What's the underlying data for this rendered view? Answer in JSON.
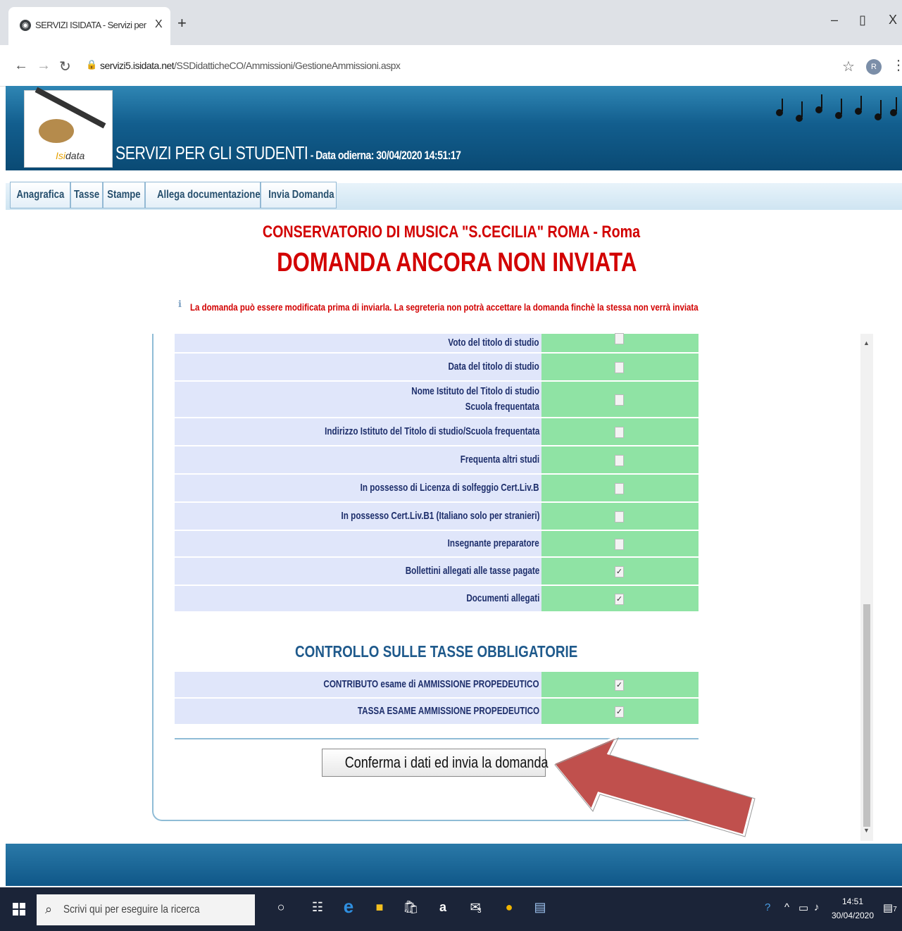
{
  "browser": {
    "tab_title": "SERVIZI ISIDATA - Servizi per gli s",
    "tab_close": "X",
    "new_tab": "+",
    "url_host": "servizi5.isidata.net",
    "url_path": "/SSDidatticheCO/Ammissioni/GestioneAmmissioni.aspx",
    "profile_initial": "R",
    "win_minimize": "–",
    "win_maximize": "▯",
    "win_close": "X"
  },
  "header": {
    "logo_brand_prefix": "Isi",
    "logo_brand_suffix": "data",
    "title": "SERVIZI PER GLI STUDENTI",
    "date_label": " - Data odierna: 30/04/2020 14:51:17"
  },
  "nav": {
    "tabs": [
      {
        "label": "Anagrafica"
      },
      {
        "label": "Tasse"
      },
      {
        "label": "Stampe"
      },
      {
        "label": "Allega documentazione"
      },
      {
        "label": "Invia Domanda"
      }
    ]
  },
  "main": {
    "institution": "CONSERVATORIO DI MUSICA \"S.CECILIA\" ROMA - Roma",
    "status": "DOMANDA ANCORA NON INVIATA",
    "info": "La domanda può essere modificata prima di inviarla. La segreteria non potrà accettare la domanda finchè la stessa non verrà inviata",
    "checks": [
      {
        "label": "Voto del titolo di studio",
        "checked": false
      },
      {
        "label": "Data del titolo di studio",
        "checked": false
      },
      {
        "label": "Nome Istituto del Titolo di studio",
        "label2": "Scuola frequentata",
        "checked": false
      },
      {
        "label": "Indirizzo Istituto del Titolo di studio/Scuola frequentata",
        "checked": false
      },
      {
        "label": "Frequenta altri studi",
        "checked": false
      },
      {
        "label": "In possesso di Licenza di solfeggio Cert.Liv.B",
        "checked": false
      },
      {
        "label": "In possesso Cert.Liv.B1 (Italiano solo per stranieri)",
        "checked": false
      },
      {
        "label": "Insegnante preparatore",
        "checked": false
      },
      {
        "label": "Bollettini allegati alle tasse pagate",
        "checked": true
      },
      {
        "label": "Documenti allegati",
        "checked": true
      }
    ],
    "tax_section_title": "CONTROLLO SULLE TASSE OBBLIGATORIE",
    "taxes": [
      {
        "label": "CONTRIBUTO esame di AMMISSIONE PROPEDEUTICO",
        "checked": true
      },
      {
        "label": "TASSA ESAME AMMISSIONE PROPEDEUTICO",
        "checked": true
      }
    ],
    "submit_label": "Conferma i dati ed invia la domanda",
    "check_mark": "✓"
  },
  "taskbar": {
    "search_placeholder": "Scrivi qui per eseguire la ricerca",
    "time": "14:51",
    "date": "30/04/2020",
    "notification_count": "7",
    "mail_badge": "3"
  },
  "colors": {
    "accent_red": "#d20000",
    "header_blue": "#125e8e",
    "row_bg": "#e0e6fa",
    "check_bg": "#8fe3a4",
    "arrow_red": "#c0504d"
  }
}
